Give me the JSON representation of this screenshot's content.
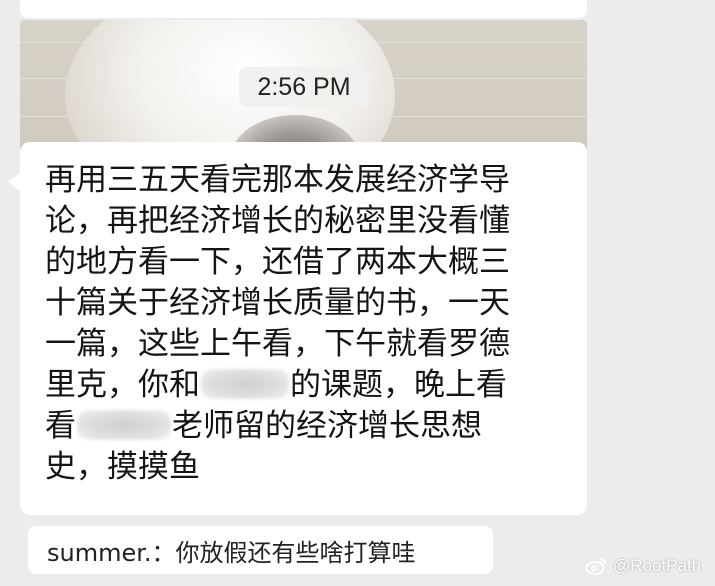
{
  "chat": {
    "timestamp": "2:56 PM",
    "message": {
      "lines": [
        "再用三五天看完那本发展经济学导",
        "论，再把经济增长的秘密里没看懂",
        "的地方看一下，还借了两本大概三",
        "十篇关于经济增长质量的书，一天",
        "一篇，这些上午看，下午就看罗德"
      ],
      "line6_start": "里克，你和",
      "line6_end": "的课题，晚上看",
      "line7_start": "看",
      "line7_end": "老师留的经济增长思想",
      "line8": "史，摸摸鱼"
    },
    "quoted_reply": "summer.：你放假还有些啥打算哇"
  },
  "watermark": {
    "text": "@RootPath",
    "icon": "weibo-icon"
  }
}
